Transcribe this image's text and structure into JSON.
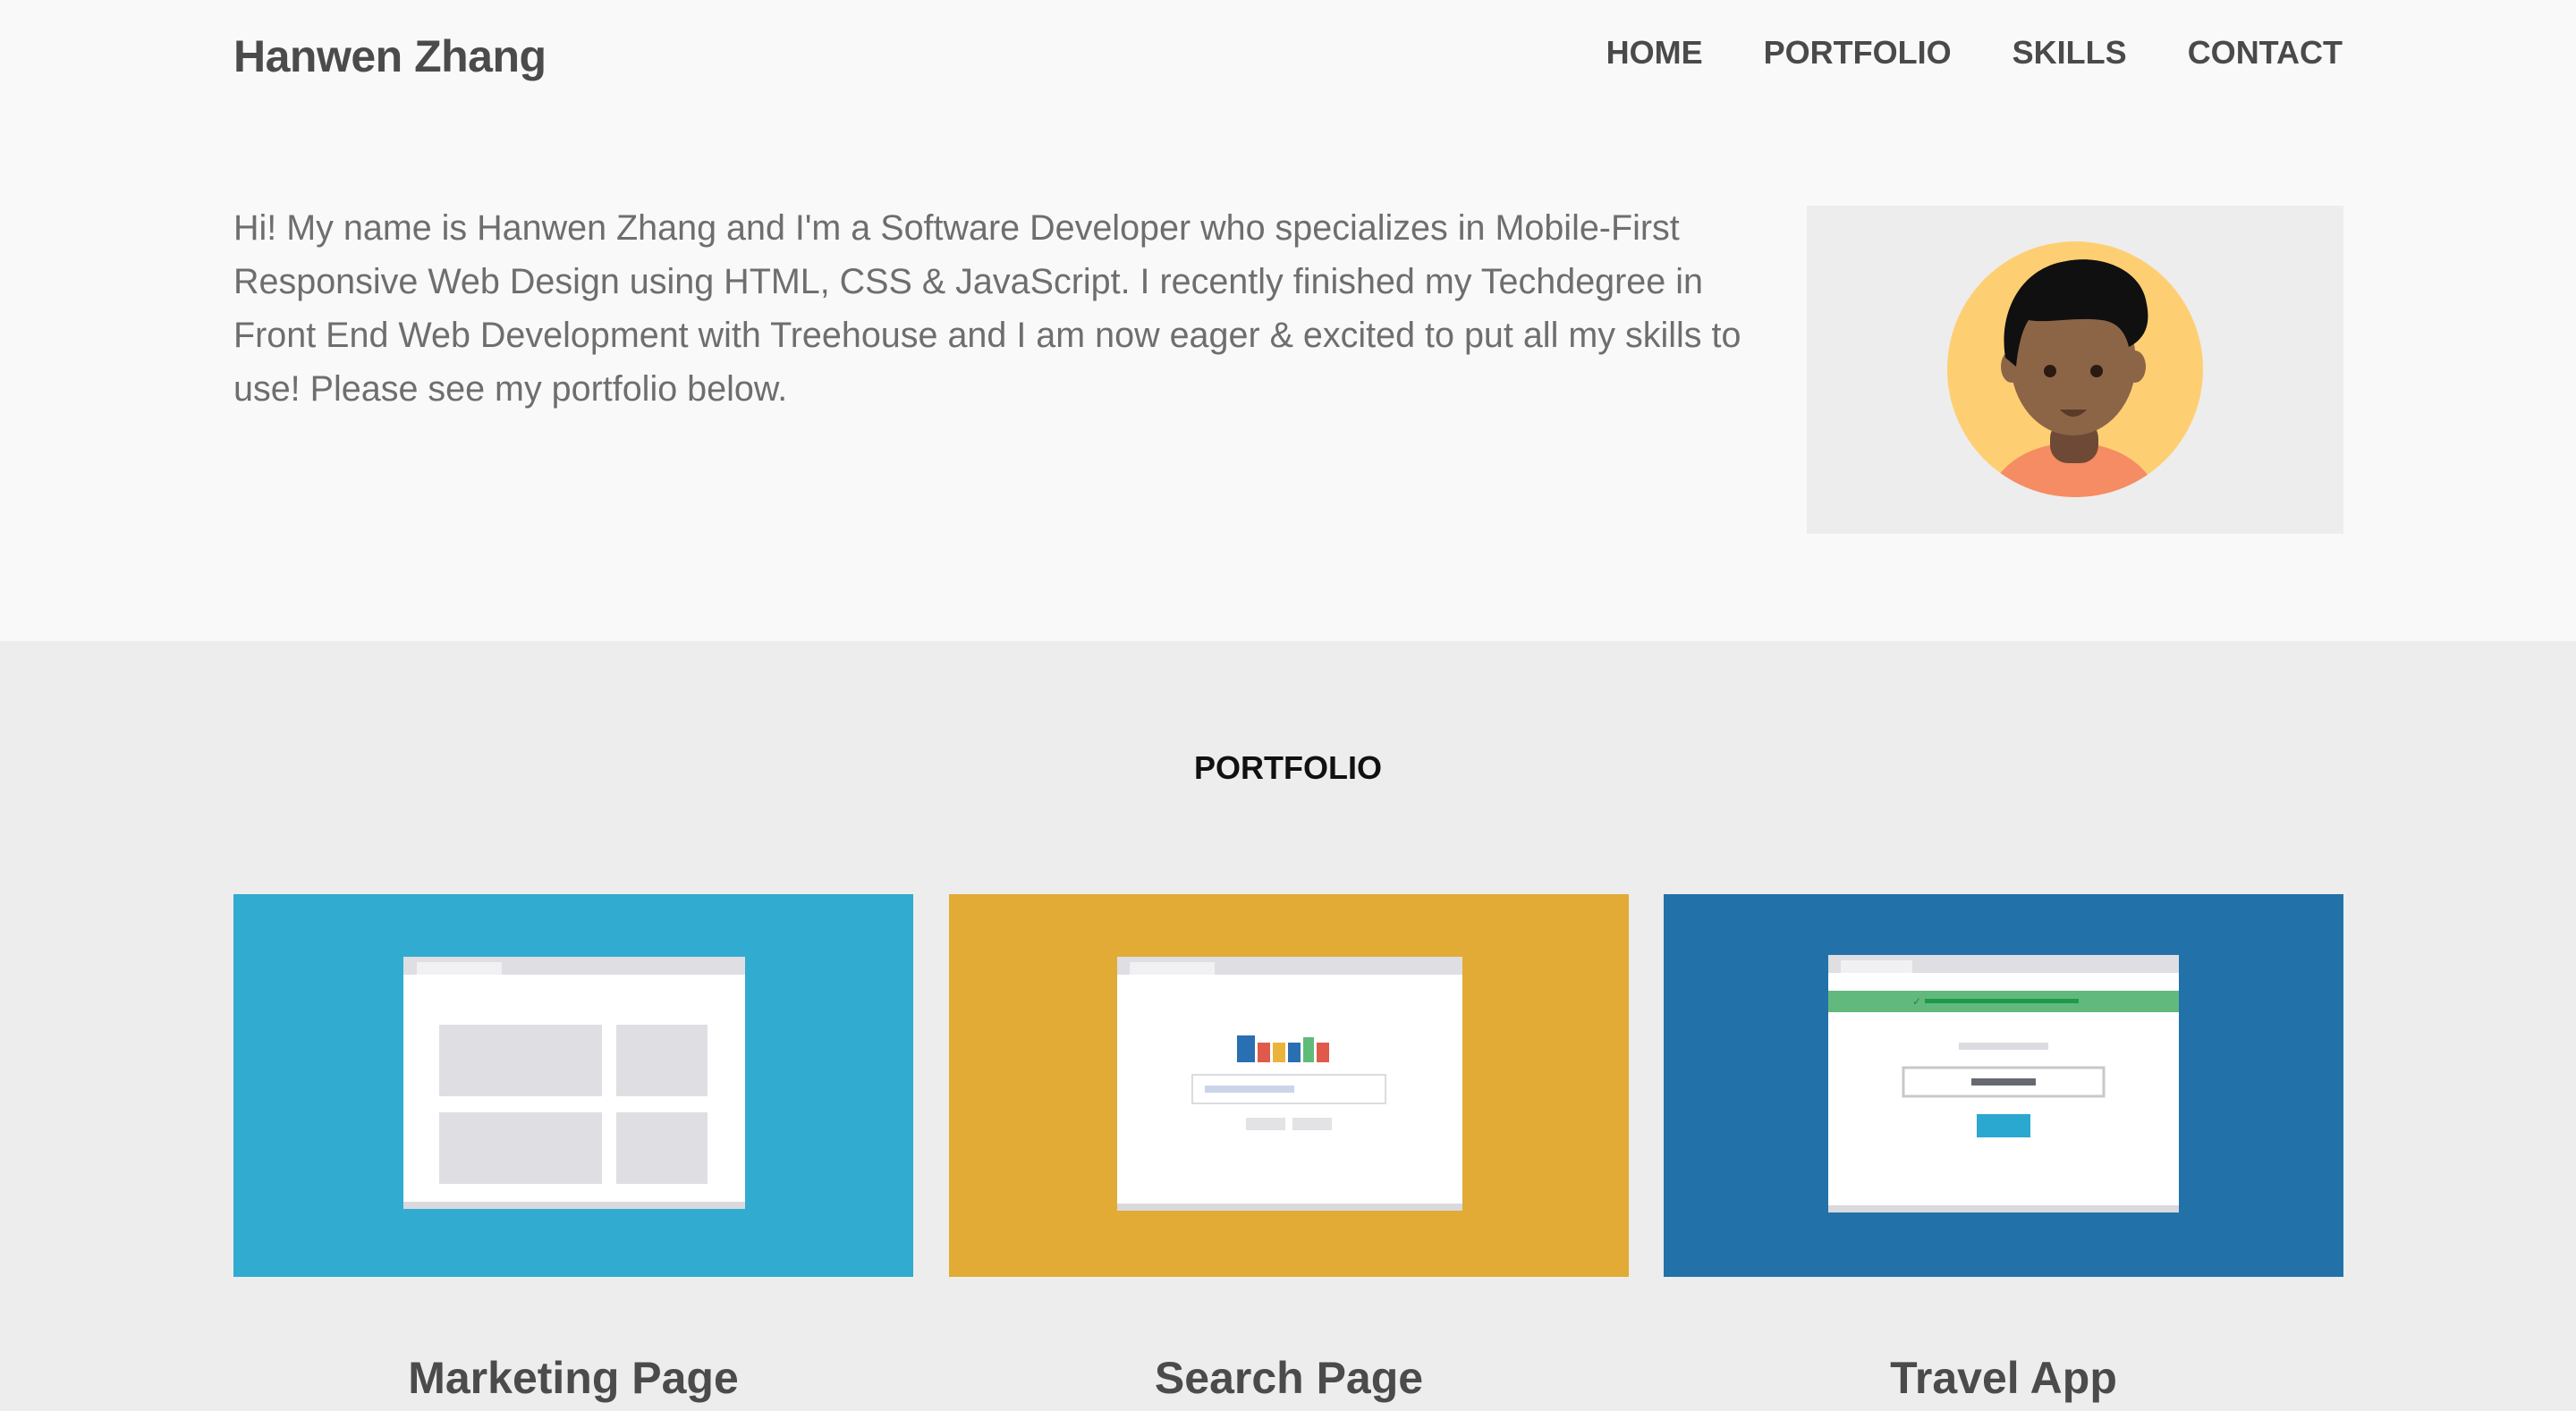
{
  "header": {
    "brand": "Hanwen Zhang",
    "nav": [
      "HOME",
      "PORTFOLIO",
      "SKILLS",
      "CONTACT"
    ]
  },
  "intro": {
    "text": "Hi! My name is Hanwen Zhang and I'm a Software Developer who specializes in Mobile-First Responsive Web Design using HTML, CSS & JavaScript. I recently finished my Techdegree in Front End Web Development with Treehouse and I am now eager & excited to put all my skills to use! Please see my portfolio below.",
    "avatar_icon": "avatar-illustration-icon"
  },
  "portfolio": {
    "title": "PORTFOLIO",
    "projects": [
      {
        "title": "Marketing Page",
        "color": "#31abd0",
        "icon": "marketing-page-thumbnail-icon"
      },
      {
        "title": "Search Page",
        "color": "#e1ab35",
        "icon": "search-page-thumbnail-icon"
      },
      {
        "title": "Travel App",
        "color": "#2272a9",
        "icon": "travel-app-thumbnail-icon"
      }
    ]
  }
}
